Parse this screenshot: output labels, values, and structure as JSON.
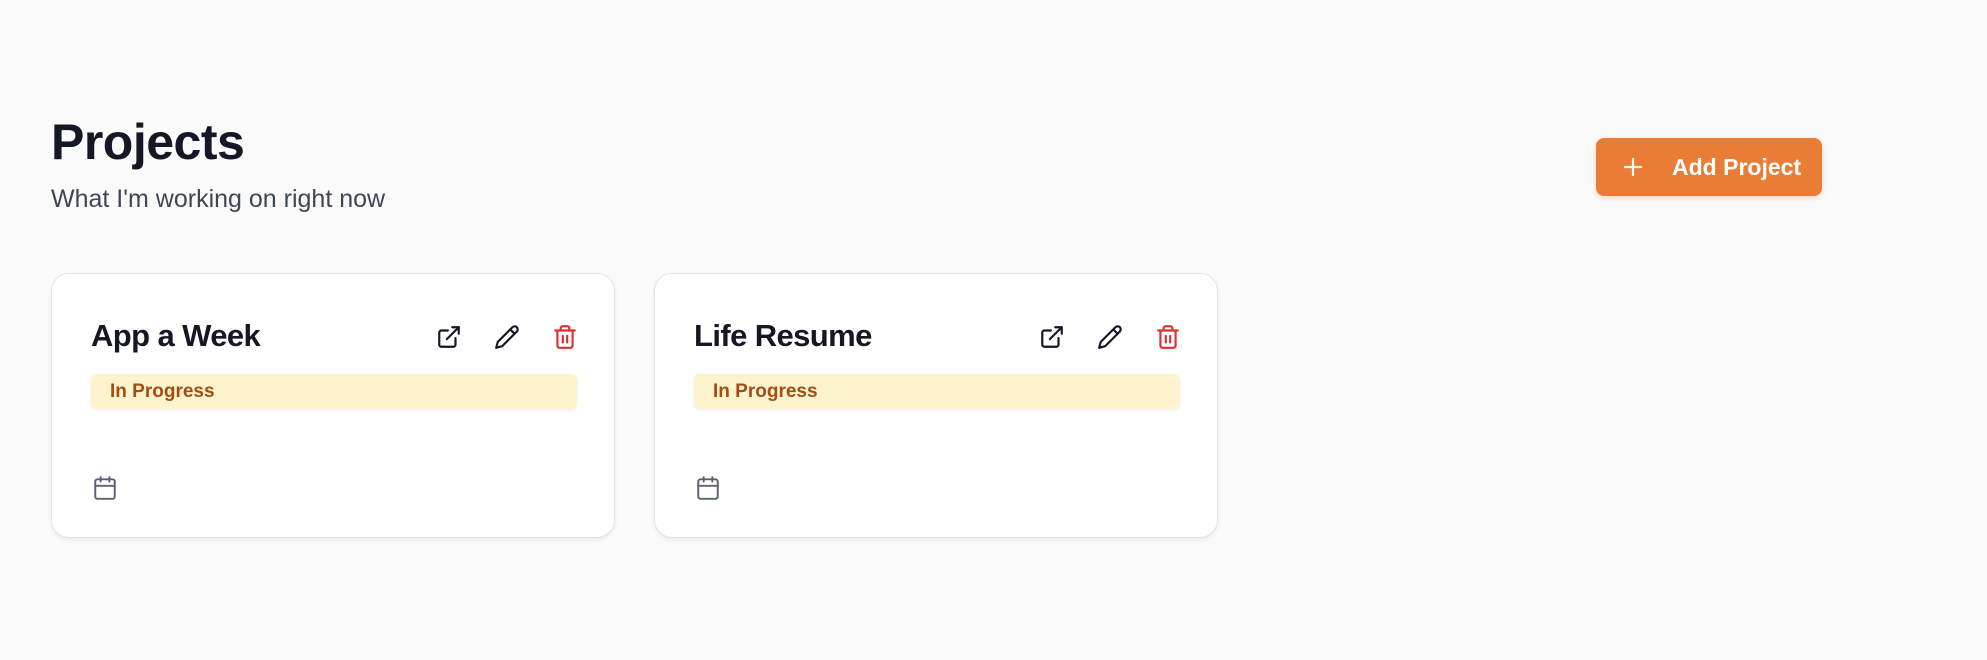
{
  "header": {
    "title": "Projects",
    "subtitle": "What I'm working on right now"
  },
  "add_button": {
    "label": "Add Project",
    "icon": "plus-icon"
  },
  "colors": {
    "accent": "#ea7d35",
    "danger": "#dc2f2f",
    "status_bg": "#fdf3cc",
    "status_text": "#a34c14"
  },
  "projects": [
    {
      "title": "App a Week",
      "status": "In Progress",
      "actions": [
        "external-link-icon",
        "pencil-icon",
        "trash-icon"
      ],
      "date_icon": "calendar-icon"
    },
    {
      "title": "Life Resume",
      "status": "In Progress",
      "actions": [
        "external-link-icon",
        "pencil-icon",
        "trash-icon"
      ],
      "date_icon": "calendar-icon"
    }
  ]
}
